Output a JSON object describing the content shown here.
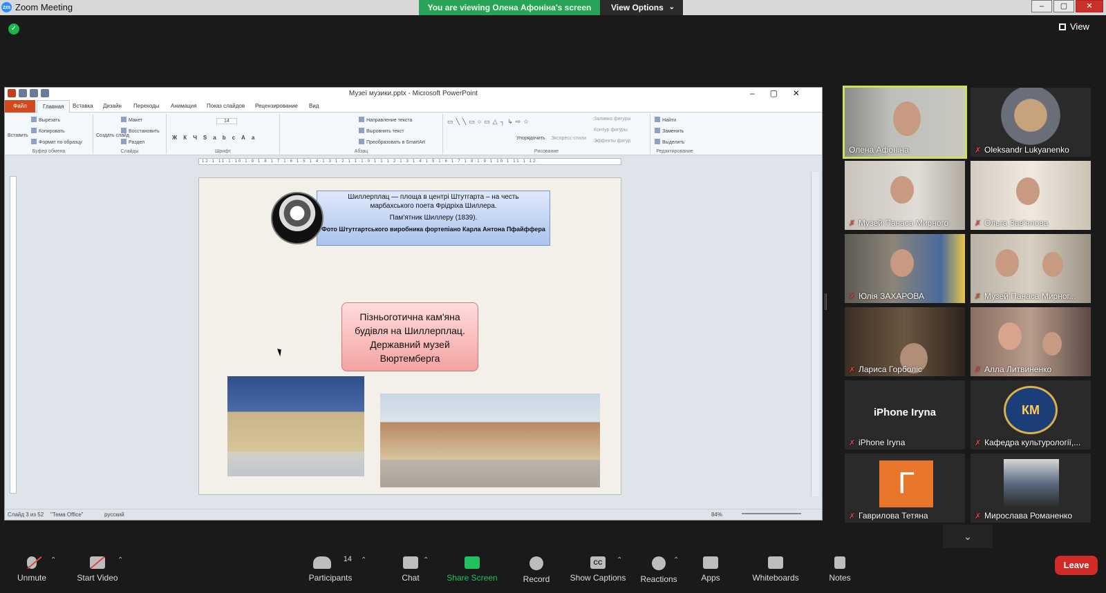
{
  "window": {
    "title": "Zoom Meeting",
    "banner": "You are viewing Олена Афоніна's screen",
    "view_options": "View Options",
    "view_label": "View"
  },
  "ppt": {
    "doc_title": "Музеї музики.pptx - Microsoft PowerPoint",
    "tabs": [
      "Файл",
      "Главная",
      "Вставка",
      "Дизайн",
      "Переходы",
      "Анимация",
      "Показ слайдов",
      "Рецензирование",
      "Вид"
    ],
    "ribbon": {
      "clipboard": {
        "paste": "Вставить",
        "cut": "Вырезать",
        "copy": "Копировать",
        "format": "Формат по образцу",
        "name": "Буфер обмена"
      },
      "slides": {
        "new": "Создать слайд",
        "layout": "Макет",
        "reset": "Восстановить",
        "section": "Раздел",
        "name": "Слайды"
      },
      "font": {
        "size": "14",
        "name": "Шрифт"
      },
      "paragraph": {
        "direction": "Направление текста",
        "align": "Выровнять текст",
        "smartart": "Преобразовать в SmartArt",
        "name": "Абзац"
      },
      "drawing": {
        "arrange": "Упорядочить",
        "styles": "Экспресс-стили",
        "fill": "Заливка фигуры",
        "outline": "Контур фигуры",
        "effects": "Эффекты фигур",
        "name": "Рисование"
      },
      "editing": {
        "find": "Найти",
        "replace": "Заменить",
        "select": "Выделить",
        "name": "Редактирование"
      }
    },
    "ruler": "·12·1·11·1·10·1·9·1·8·1·7·1·6·1·5·1·4·1·3·1·2·1·1·1·0·1·1·1·2·1·3·1·4·1·5·1·6·1·7·1·8·1·9·1·10·1·11·1·12·",
    "slide": {
      "callout_line1": "Шиллерплац — площа в центрі Штутгарта – на честь",
      "callout_line2": "марбахського поета Фрідріха Шиллера.",
      "callout_line3": "Пам'ятник Шиллеру (1839).",
      "callout_line4": "Фото Штутгартського виробника фортепіано Карла Антона Пфайффера",
      "pink_text": "Пізньоготична кам'яна будівля на Шиллерплац. Державний музей Вюртемберга"
    },
    "status": {
      "slide": "Слайд 3 из 52",
      "theme": "\"Тема Office\"",
      "lang": "русский",
      "zoom": "84%"
    }
  },
  "participants": [
    {
      "name": "Олена Афоніна",
      "muted": false,
      "active": true
    },
    {
      "name": "Oleksandr Lukyanenko",
      "muted": true
    },
    {
      "name": "Музей Панаса Мирного",
      "muted": true
    },
    {
      "name": "Ольга Зав'ялова",
      "muted": true
    },
    {
      "name": "Юлія ЗАХАРОВА",
      "muted": true
    },
    {
      "name": "Музей Панаса Мирног...",
      "muted": true
    },
    {
      "name": "Лариса Горболіс",
      "muted": true
    },
    {
      "name": "Алла Литвиненко",
      "muted": true
    },
    {
      "name": "iPhone Iryna",
      "muted": true,
      "big_name": "iPhone Iryna"
    },
    {
      "name": "Кафедра культурології,...",
      "muted": true,
      "logo_text": "КМ"
    },
    {
      "name": "Гаврилова Тетяна",
      "muted": true,
      "avatar_letter": "Г"
    },
    {
      "name": "Мирослава Романенко",
      "muted": true
    }
  ],
  "toolbar": {
    "unmute": "Unmute",
    "start_video": "Start Video",
    "participants": "Participants",
    "participants_count": "14",
    "chat": "Chat",
    "share": "Share Screen",
    "record": "Record",
    "captions": "Show Captions",
    "captions_icon": "CC",
    "reactions": "Reactions",
    "apps": "Apps",
    "whiteboards": "Whiteboards",
    "notes": "Notes",
    "leave": "Leave"
  }
}
